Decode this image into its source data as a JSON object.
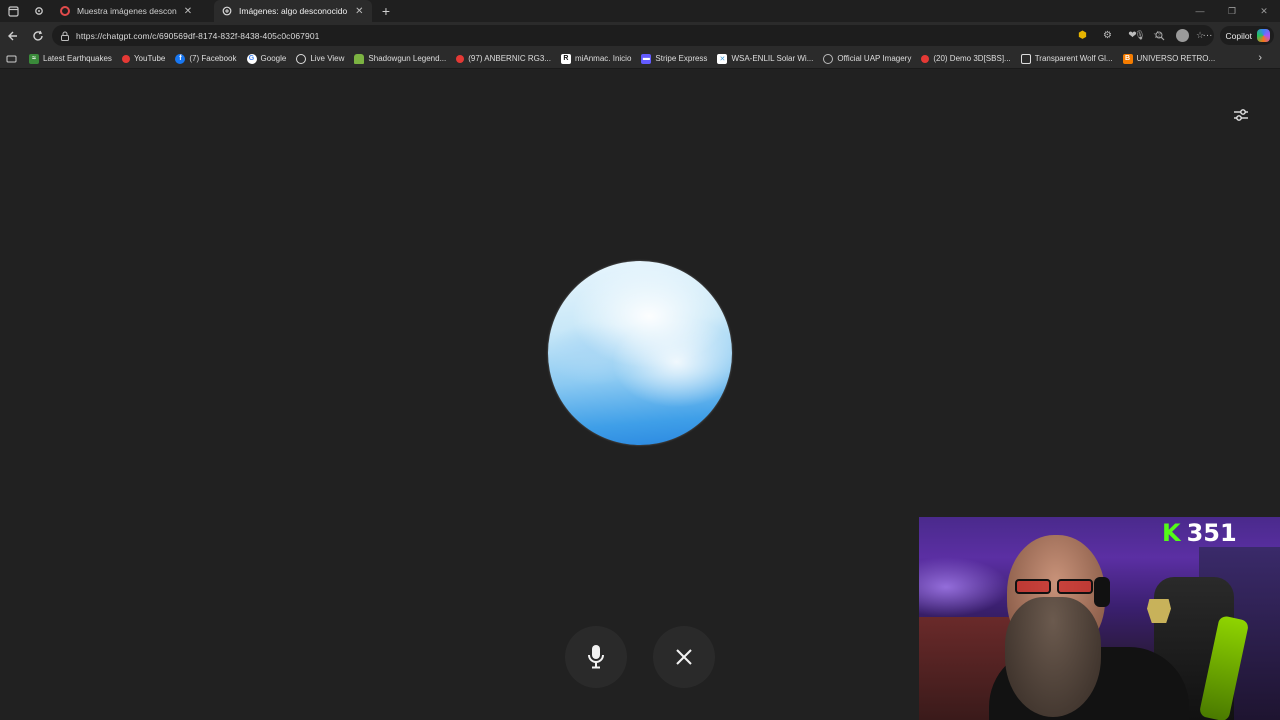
{
  "tabs": [
    {
      "title": "Muestra imágenes desconoc",
      "state": "inactive",
      "favicon_color": "#e24b4b"
    },
    {
      "title": "Imágenes: algo desconocido para",
      "state": "active",
      "favicon_color": "#d9d9d9"
    }
  ],
  "address_bar": {
    "url": "https://chatgpt.com/c/690569df-8174-832f-8438-405c0c067901"
  },
  "copilot_label": "Copilot",
  "bookmarks": [
    {
      "label": "Latest Earthquakes",
      "icon": "earthquake-icon",
      "color": "#3a8a3a"
    },
    {
      "label": "YouTube",
      "icon": "youtube-icon",
      "color": "#e53935"
    },
    {
      "label": "(7) Facebook",
      "icon": "facebook-icon",
      "color": "#1877f2"
    },
    {
      "label": "Google",
      "icon": "google-icon",
      "color": "#ffffff"
    },
    {
      "label": "Live View",
      "icon": "liveview-icon",
      "color": "#dddddd"
    },
    {
      "label": "Shadowgun Legend...",
      "icon": "android-icon",
      "color": "#7cb342"
    },
    {
      "label": "(97) ANBERNIC RG3...",
      "icon": "youtube-icon",
      "color": "#e53935"
    },
    {
      "label": "miAnmac. Inicio",
      "icon": "r-icon",
      "color": "#ffffff"
    },
    {
      "label": "Stripe Express",
      "icon": "stripe-icon",
      "color": "#635bff"
    },
    {
      "label": "WSA-ENLIL Solar Wi...",
      "icon": "noaa-icon",
      "color": "#4aa3df"
    },
    {
      "label": "Official UAP Imagery",
      "icon": "uap-icon",
      "color": "#bbbbbb"
    },
    {
      "label": "(20) Demo 3D[SBS]...",
      "icon": "youtube-icon",
      "color": "#e53935"
    },
    {
      "label": "Transparent Wolf Gl...",
      "icon": "page-icon",
      "color": "#dddddd"
    },
    {
      "label": "UNIVERSO RETRO...",
      "icon": "blogger-icon",
      "color": "#f57c00"
    }
  ],
  "voice_mode": {
    "orb_colors": [
      "#e9f6fd",
      "#8ccaf2",
      "#2a87e0"
    ],
    "mic_label": "",
    "close_label": ""
  },
  "webcam": {
    "kick_letter": "K",
    "viewer_count": "351",
    "kick_color": "#53fc18"
  }
}
